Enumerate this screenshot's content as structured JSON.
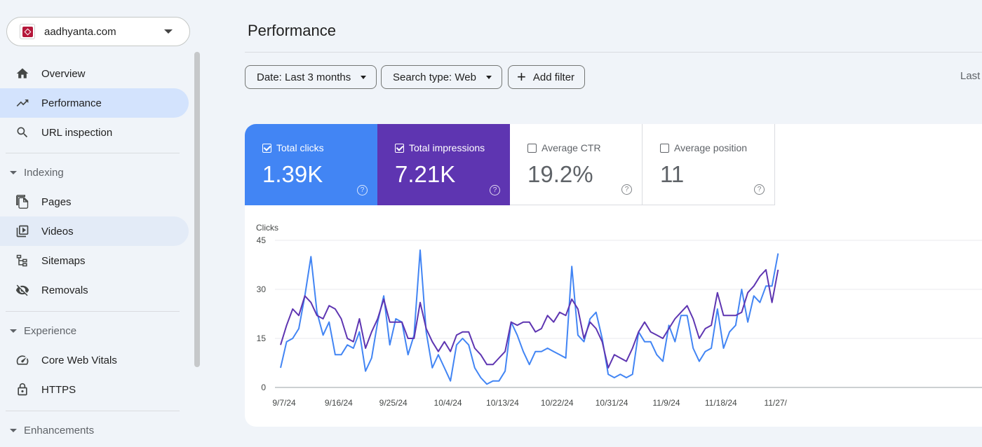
{
  "property": {
    "name": "aadhyanta.com"
  },
  "nav": {
    "overview": "Overview",
    "performance": "Performance",
    "url_inspection": "URL inspection",
    "indexing_header": "Indexing",
    "pages": "Pages",
    "videos": "Videos",
    "sitemaps": "Sitemaps",
    "removals": "Removals",
    "experience_header": "Experience",
    "core_web_vitals": "Core Web Vitals",
    "https": "HTTPS",
    "enhancements_header": "Enhancements"
  },
  "page": {
    "title": "Performance"
  },
  "filters": {
    "date": "Date: Last 3 months",
    "search_type": "Search type: Web",
    "add_filter": "Add filter",
    "last_label": "Last"
  },
  "metrics": {
    "clicks": {
      "label": "Total clicks",
      "value": "1.39K",
      "checked": true,
      "color": "#4285f4"
    },
    "impressions": {
      "label": "Total impressions",
      "value": "7.21K",
      "checked": true,
      "color": "#5e35b1"
    },
    "ctr": {
      "label": "Average CTR",
      "value": "19.2%",
      "checked": false
    },
    "position": {
      "label": "Average position",
      "value": "11",
      "checked": false
    }
  },
  "chart_data": {
    "type": "line",
    "ylabel": "Clicks",
    "ylim": [
      0,
      45
    ],
    "yticks": [
      0,
      15,
      30,
      45
    ],
    "xtick_labels": [
      "9/7/24",
      "9/16/24",
      "9/25/24",
      "10/4/24",
      "10/13/24",
      "10/22/24",
      "10/31/24",
      "11/9/24",
      "11/18/24",
      "11/27/"
    ],
    "x_start": "9/7/24",
    "grid": true,
    "series": [
      {
        "color": "#4285f4",
        "values": [
          6,
          14,
          15,
          18,
          28,
          40,
          23,
          16,
          20,
          10,
          10,
          13,
          12,
          17,
          5,
          9,
          20,
          28,
          13,
          21,
          20,
          10,
          16,
          42,
          17,
          6,
          10,
          6,
          2,
          13,
          15,
          13,
          6,
          3,
          1,
          2,
          2,
          5,
          20,
          16,
          11,
          7,
          11,
          11,
          12,
          11,
          10,
          9,
          37,
          16,
          14,
          21,
          23,
          15,
          4,
          3,
          4,
          3,
          4,
          17,
          14,
          14,
          10,
          8,
          19,
          14,
          22,
          22,
          12,
          8,
          11,
          12,
          24,
          12,
          17,
          19,
          30,
          20,
          28,
          26,
          31,
          31,
          41
        ]
      },
      {
        "color": "#5e35b1",
        "values": [
          13,
          19,
          24,
          22,
          28,
          26,
          22,
          21,
          25,
          24,
          21,
          15,
          14,
          21,
          12,
          17,
          21,
          27,
          20,
          20,
          20,
          15,
          15,
          26,
          18,
          14,
          11,
          14,
          11,
          16,
          17,
          17,
          12,
          10,
          7,
          7,
          9,
          11,
          20,
          19,
          20,
          20,
          17,
          18,
          22,
          20,
          23,
          22,
          27,
          24,
          15,
          20,
          18,
          14,
          6,
          10,
          9,
          8,
          12,
          17,
          20,
          17,
          16,
          15,
          18,
          21,
          23,
          25,
          21,
          15,
          18,
          19,
          29,
          22,
          22,
          22,
          23,
          29,
          31,
          34,
          36,
          26,
          36
        ]
      }
    ]
  }
}
